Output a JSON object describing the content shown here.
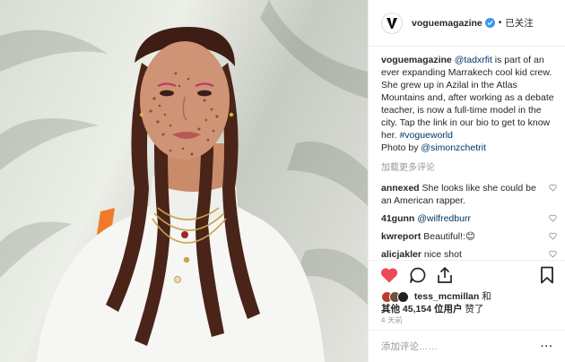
{
  "post": {
    "image_alt": "Portrait of a woman with freckles and long braids wearing a white turtleneck and gold necklaces"
  },
  "header": {
    "username": "voguemagazine",
    "separator": "•",
    "follow_status": "已关注"
  },
  "caption": {
    "username": "voguemagazine",
    "mention": "@tadxrfit",
    "text_1": " is part of an ever expanding Marrakech cool kid crew. She grew up in Azilal in the Atlas Mountains and, after working as a debate teacher, is now a full-time model in the city. Tap the link in our bio to get to know her. ",
    "hashtag": "#vogueworld",
    "text_2": "Photo by ",
    "photographer": "@simonzchetrit"
  },
  "load_more": "加载更多评论",
  "comments": [
    {
      "username": "annexed",
      "text": "She looks like she could be an American rapper."
    },
    {
      "username": "41gunn",
      "text": "@wilfredburr"
    },
    {
      "username": "kwreport",
      "text": "Beautiful!:",
      "emoji": "😊"
    },
    {
      "username": "alicjakler",
      "text": "nice shot"
    }
  ],
  "likes": {
    "liked_by": "tess_mcmillan",
    "conj": " 和",
    "others_prefix": "其他 ",
    "count": "45,154",
    "others_suffix": " 位用户",
    "liked": " 赞了"
  },
  "timestamp": "4 天前",
  "add_comment": {
    "placeholder": "添加评论……",
    "more": "···"
  },
  "colors": {
    "heart_liked": "#ed4956",
    "verified": "#3897f0",
    "link": "#003569"
  }
}
